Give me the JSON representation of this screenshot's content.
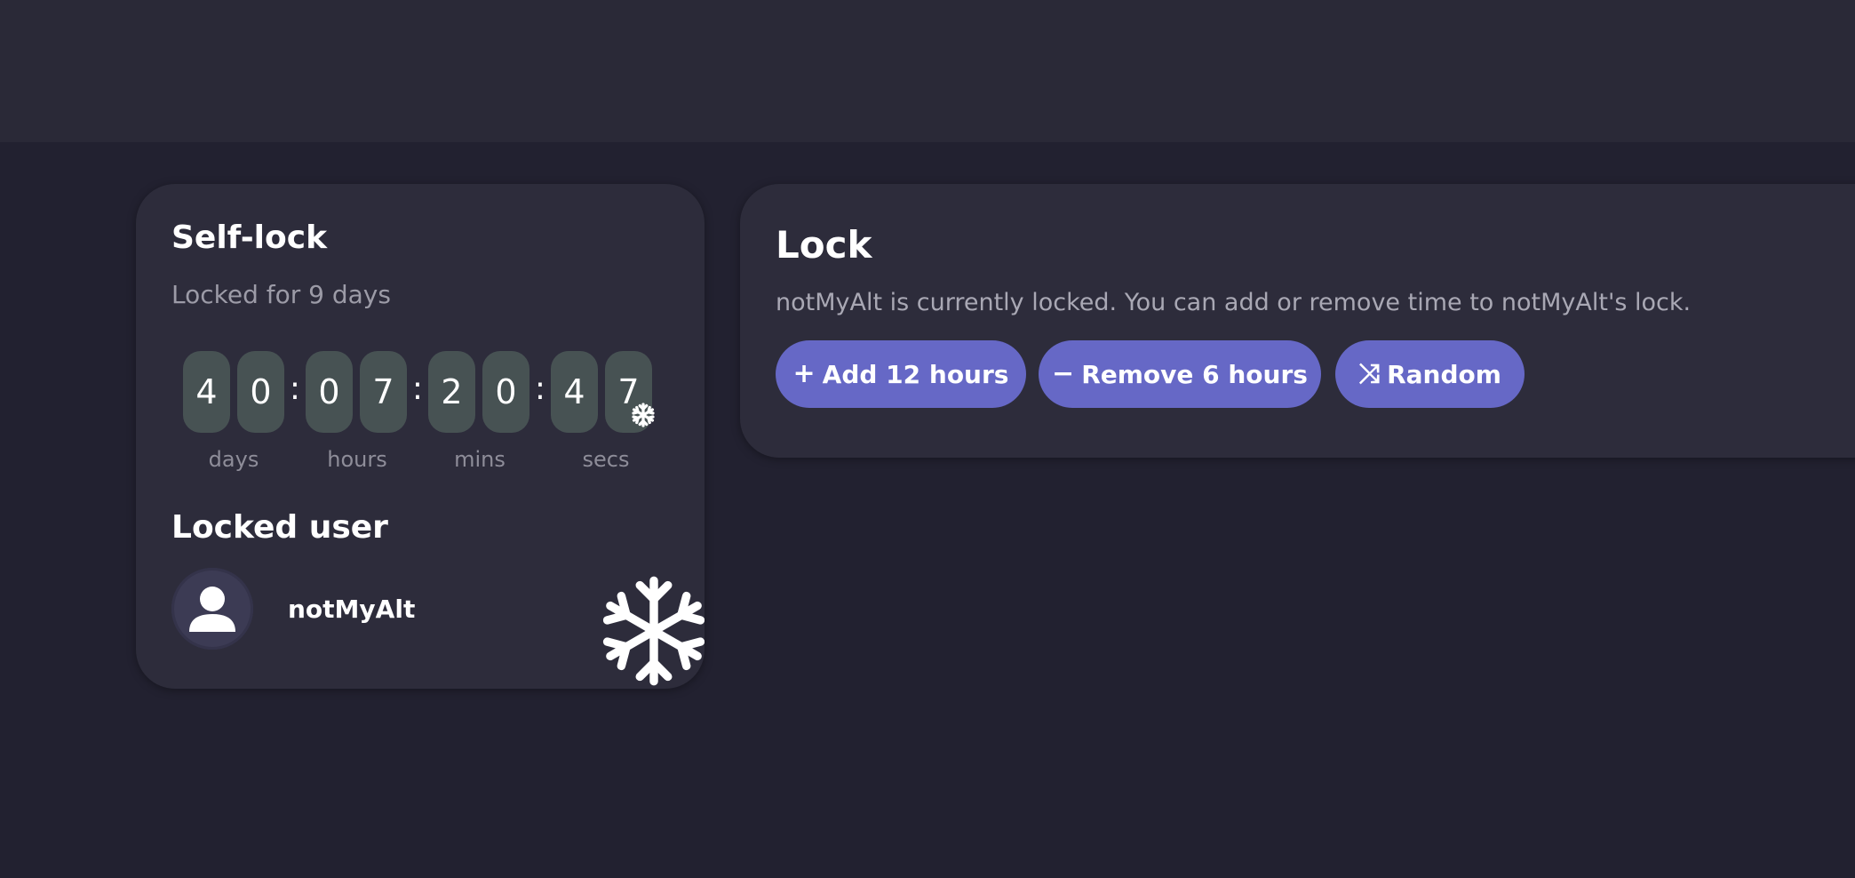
{
  "self_lock": {
    "title": "Self-lock",
    "subtitle": "Locked for 9 days",
    "timer": {
      "digits": [
        "4",
        "0",
        "0",
        "7",
        "2",
        "0",
        "4",
        "7"
      ],
      "separator": ":",
      "units": [
        "days",
        "hours",
        "mins",
        "secs"
      ]
    },
    "locked_user_title": "Locked user",
    "username": "notMyAlt",
    "icons": [
      "snowflake-icon",
      "user-avatar-icon"
    ]
  },
  "lock": {
    "title": "Lock",
    "description": "notMyAlt is currently locked. You can add or remove time to notMyAlt's lock.",
    "buttons": [
      {
        "icon": "+",
        "label": "Add 12 hours"
      },
      {
        "icon": "−",
        "label": "Remove 6 hours"
      },
      {
        "icon": "⤨",
        "label": "Random"
      }
    ]
  },
  "colors": {
    "background": "#222130",
    "card": "#2d2c3b",
    "digit_tile": "#475253",
    "button": "#6668c6"
  }
}
